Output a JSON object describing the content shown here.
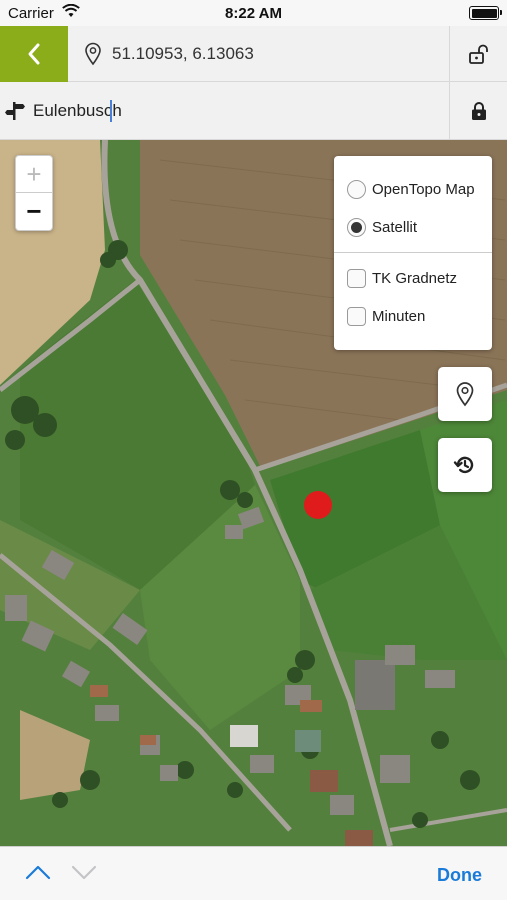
{
  "status_bar": {
    "carrier": "Carrier",
    "time": "8:22 AM",
    "wifi_icon": "wifi-icon",
    "battery_icon": "battery-icon"
  },
  "header": {
    "back_icon": "chevron-left-icon",
    "accent_color": "#8cad1a",
    "coordinates": "51.10953, 6.13063",
    "coordinate_icon": "location-pin-icon",
    "coordinate_lock_icon": "unlocked-padlock-icon",
    "place_icon": "signpost-icon",
    "place_value": "Eulenbusch",
    "place_lock_icon": "locked-padlock-icon"
  },
  "map": {
    "zoom_in": "+",
    "zoom_out": "−",
    "layers": {
      "base": [
        {
          "label": "OpenTopo Map",
          "selected": false
        },
        {
          "label": "Satellit",
          "selected": true
        }
      ],
      "overlays": [
        {
          "label": "TK Gradnetz",
          "checked": false
        },
        {
          "label": "Minuten",
          "checked": false
        }
      ]
    },
    "location_button_icon": "location-pin-icon",
    "history_button_icon": "history-icon",
    "marker_color": "#e01b1b"
  },
  "accessory_bar": {
    "previous_icon": "chevron-up-icon",
    "next_icon": "chevron-down-icon",
    "done_label": "Done",
    "done_color": "#1a7bd8"
  }
}
